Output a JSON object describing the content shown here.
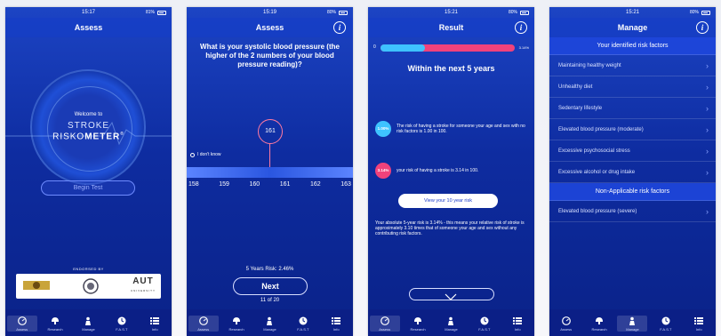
{
  "screens": [
    {
      "time": "15:17",
      "battery": "81%",
      "title": "Assess",
      "welcome": "Welcome to",
      "logo_top": "STROKE",
      "logo_left": "RISKO",
      "logo_right": "METER",
      "registered": "®",
      "begin_button": "Begin Test",
      "endorsed_by": "ENDORSED BY",
      "aut_logo": "AUT",
      "aut_sub": "UNIVERSITY"
    },
    {
      "time": "15:19",
      "battery": "80%",
      "title": "Assess",
      "info": "i",
      "question": "What is your systolic blood pressure (the higher of the 2 numbers of your blood pressure reading)?",
      "dont_know": "I don't know",
      "selected_value": "161",
      "ticks": [
        "158",
        "159",
        "160",
        "161",
        "162",
        "163"
      ],
      "risk": "5 Years Risk: 2.46%",
      "next_button": "Next",
      "page_count": "11 of 20"
    },
    {
      "time": "15:21",
      "battery": "80%",
      "title": "Result",
      "info": "i",
      "bar_left": "0",
      "bar_right": "3.14%",
      "bar_fill_fraction": 0.33,
      "within": "Within the next 5 years",
      "baseline_pct": "1.00%",
      "baseline_text": "The risk of having a stroke for someone your age and sex with no risk factors is 1.00 in 100.",
      "your_pct": "3.14%",
      "your_text": "your risk of having a stroke is 3.14 in 100.",
      "view_10yr": "View your 10 year risk",
      "absolute_text": "Your absolute 5-year risk is 3.14% - this means your relative risk of stroke is approximately 3.10 times that of someone your age and sex without any contributing risk factors."
    },
    {
      "time": "15:21",
      "battery": "80%",
      "title": "Manage",
      "info": "i",
      "identified_header": "Your identified risk factors",
      "identified": [
        "Maintaining healthy weight",
        "Unhealthy diet",
        "Sedentary lifestyle",
        "Elevated blood pressure (moderate)",
        "Excessive psychosocial stress",
        "Excessive alcohol or drug intake"
      ],
      "nonapplicable_header": "Non-Applicable risk factors",
      "nonapplicable": [
        "Elevated blood pressure (severe)"
      ]
    }
  ],
  "tabs": [
    {
      "label": "Assess",
      "icon": "gauge-icon"
    },
    {
      "label": "Research",
      "icon": "brain-icon"
    },
    {
      "label": "Manage",
      "icon": "person-icon"
    },
    {
      "label": "F.A.S.T",
      "icon": "clock-icon"
    },
    {
      "label": "Info",
      "icon": "list-icon"
    }
  ],
  "colors": {
    "primary": "#1c44c4",
    "tabbar": "#0b1f86",
    "risk_blue": "#3ec3ff",
    "risk_pink": "#f0427b"
  }
}
